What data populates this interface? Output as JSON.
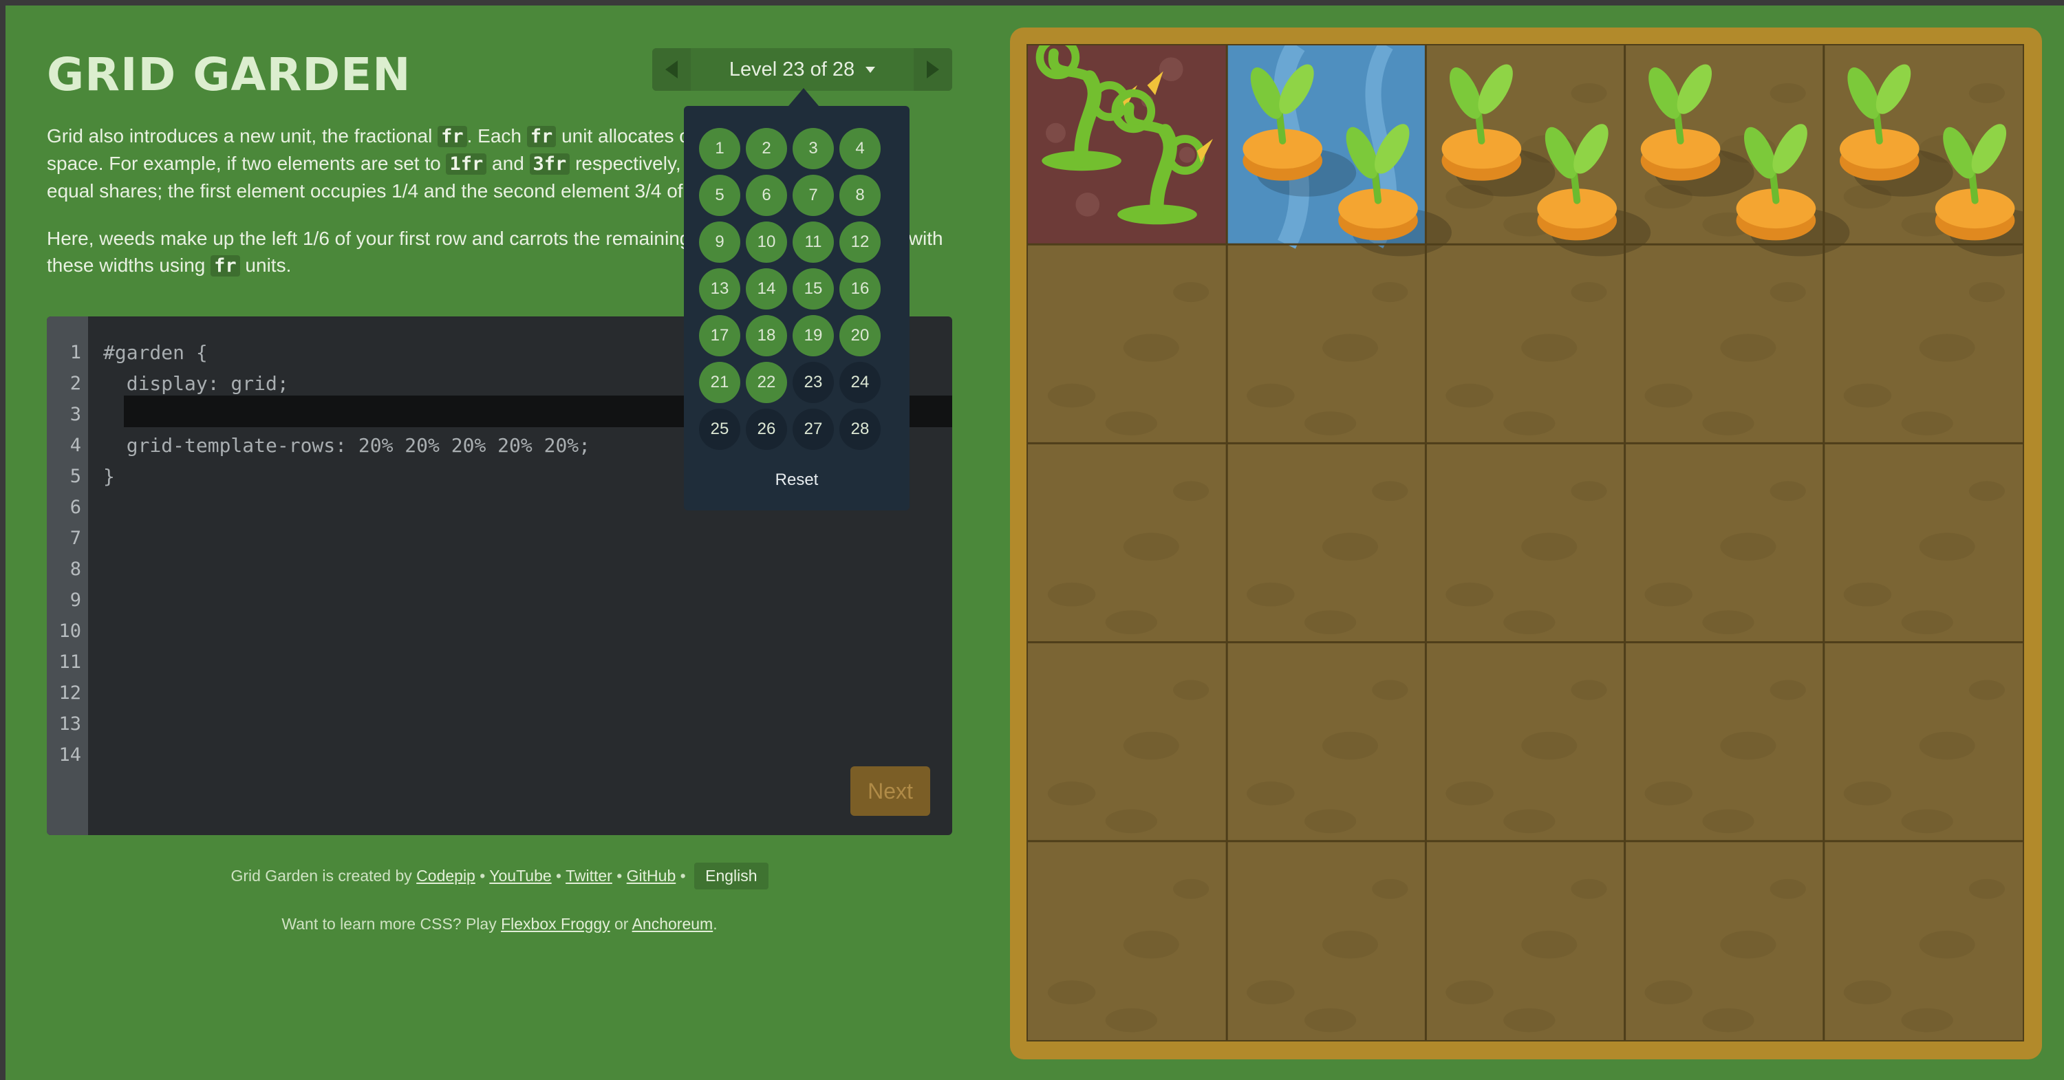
{
  "app": {
    "title": "GRID GARDEN"
  },
  "level_nav": {
    "label": "Level 23 of 28",
    "current": 23,
    "total": 28
  },
  "instructions": {
    "p1_parts": [
      "Grid also introduces a new unit, the fractional ",
      "fr",
      ". Each ",
      "fr",
      " unit allocates one share of the available space. For example, if two elements are set to ",
      "1fr",
      " and ",
      "3fr",
      " respectively, the space is divided into 4 equal shares; the first element occupies 1/4 and the second element 3/4 of the leftover space."
    ],
    "p2_parts": [
      "Here, weeds make up the left 1/6 of your first row and carrots the remaining 5/6. Create two columns with these widths using ",
      "fr",
      " units."
    ]
  },
  "editor": {
    "line_numbers": [
      "1",
      "2",
      "3",
      "4",
      "5",
      "6",
      "7",
      "8",
      "9",
      "10",
      "11",
      "12",
      "13",
      "14"
    ],
    "lines": [
      "#garden {",
      "  display: grid;",
      "",
      "  grid-template-rows: 20% 20% 20% 20% 20%;",
      "}"
    ],
    "input_value": "",
    "next_label": "Next"
  },
  "level_dropdown": {
    "levels": [
      {
        "n": "1",
        "state": "solved"
      },
      {
        "n": "2",
        "state": "solved"
      },
      {
        "n": "3",
        "state": "solved"
      },
      {
        "n": "4",
        "state": "solved"
      },
      {
        "n": "5",
        "state": "solved"
      },
      {
        "n": "6",
        "state": "solved"
      },
      {
        "n": "7",
        "state": "solved"
      },
      {
        "n": "8",
        "state": "solved"
      },
      {
        "n": "9",
        "state": "solved"
      },
      {
        "n": "10",
        "state": "solved"
      },
      {
        "n": "11",
        "state": "solved"
      },
      {
        "n": "12",
        "state": "solved"
      },
      {
        "n": "13",
        "state": "solved"
      },
      {
        "n": "14",
        "state": "solved"
      },
      {
        "n": "15",
        "state": "solved"
      },
      {
        "n": "16",
        "state": "solved"
      },
      {
        "n": "17",
        "state": "solved"
      },
      {
        "n": "18",
        "state": "solved"
      },
      {
        "n": "19",
        "state": "solved"
      },
      {
        "n": "20",
        "state": "solved"
      },
      {
        "n": "21",
        "state": "solved"
      },
      {
        "n": "22",
        "state": "solved"
      },
      {
        "n": "23",
        "state": "current"
      },
      {
        "n": "24",
        "state": "unsolved"
      },
      {
        "n": "25",
        "state": "unsolved"
      },
      {
        "n": "26",
        "state": "unsolved"
      },
      {
        "n": "27",
        "state": "unsolved"
      },
      {
        "n": "28",
        "state": "unsolved"
      }
    ],
    "reset_label": "Reset"
  },
  "credits": {
    "prefix": "Grid Garden is created by ",
    "codepip": "Codepip",
    "sep": " • ",
    "youtube": "YouTube",
    "twitter": "Twitter",
    "github": "GitHub",
    "language": "English"
  },
  "promo": {
    "prefix": "Want to learn more CSS? Play ",
    "flexbox": "Flexbox Froggy",
    "or": " or ",
    "anchoreum": "Anchoreum",
    "suffix": "."
  },
  "garden": {
    "colors": {
      "soil": "#7b6534",
      "weeds": "#6d3b38",
      "water": "#4f8fbf",
      "frame": "#b28a2b"
    },
    "grid_size": 5,
    "first_row": [
      "weeds",
      "water",
      "carrots",
      "carrots",
      "carrots"
    ]
  }
}
